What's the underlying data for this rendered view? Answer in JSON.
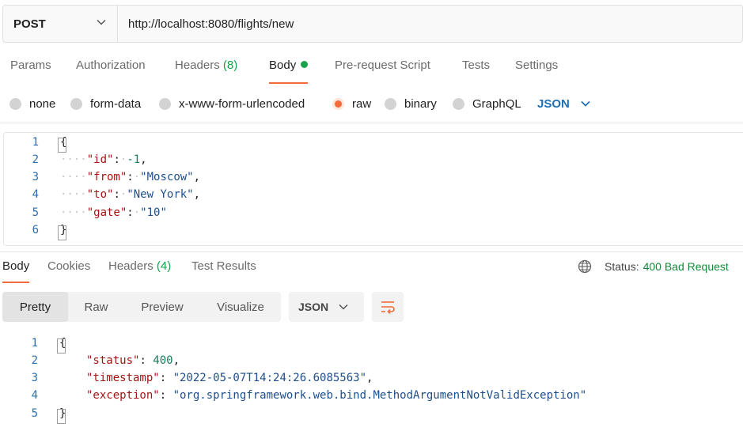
{
  "request": {
    "method": "POST",
    "url": "http://localhost:8080/flights/new"
  },
  "request_tabs": {
    "params": "Params",
    "authorization": "Authorization",
    "headers": "Headers",
    "headers_count": "(8)",
    "body": "Body",
    "prerequest": "Pre-request Script",
    "tests": "Tests",
    "settings": "Settings"
  },
  "body_types": {
    "none": "none",
    "form_data": "form-data",
    "urlencoded": "x-www-form-urlencoded",
    "raw": "raw",
    "binary": "binary",
    "graphql": "GraphQL",
    "selected": "raw",
    "language": "JSON"
  },
  "request_body": {
    "line_numbers": [
      "1",
      "2",
      "3",
      "4",
      "5",
      "6"
    ],
    "open_brace": "{",
    "close_brace": "}",
    "indent": "····",
    "id_key": "\"id\"",
    "id_value": "-1",
    "from_key": "\"from\"",
    "from_value": "\"Moscow\"",
    "to_key": "\"to\"",
    "to_value": "\"New York\"",
    "gate_key": "\"gate\"",
    "gate_value": "\"10\""
  },
  "response_tabs": {
    "body": "Body",
    "cookies": "Cookies",
    "headers": "Headers",
    "headers_count": "(4)",
    "test_results": "Test Results"
  },
  "response_status": {
    "label": "Status:",
    "value": "400 Bad Request"
  },
  "view_modes": {
    "pretty": "Pretty",
    "raw": "Raw",
    "preview": "Preview",
    "visualize": "Visualize",
    "selected": "Pretty",
    "format": "JSON"
  },
  "response_body": {
    "line_numbers": [
      "1",
      "2",
      "3",
      "4",
      "5"
    ],
    "open_brace": "{",
    "close_brace": "}",
    "status_key": "\"status\"",
    "status_value": "400",
    "timestamp_key": "\"timestamp\"",
    "timestamp_value": "\"2022-05-07T14:24:26.6085563\"",
    "exception_key": "\"exception\"",
    "exception_value": "\"org.springframework.web.bind.MethodArgumentNotValidException\""
  },
  "colors": {
    "accent": "#f26b3a",
    "success": "#16a34a",
    "link": "#1f6fb5"
  },
  "icons": {
    "method_dropdown": "chevron-down-icon",
    "language_dropdown": "chevron-down-icon",
    "status_globe": "globe-icon",
    "wrap": "wrap-lines-icon"
  }
}
